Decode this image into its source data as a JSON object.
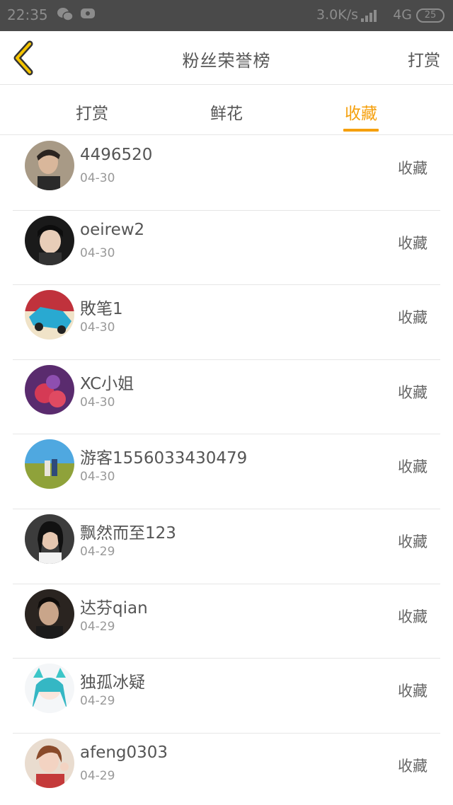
{
  "status_bar": {
    "time": "22:35",
    "network_speed": "3.0K/s",
    "network_type": "4G",
    "battery": "25",
    "icons": [
      "wechat-icon",
      "chat-bubble-icon",
      "signal-icon"
    ]
  },
  "header": {
    "title": "粉丝荣誉榜",
    "right_action": "打赏",
    "back_icon": "chevron-left-icon"
  },
  "tabs": [
    {
      "label": "打赏",
      "active": false
    },
    {
      "label": "鲜花",
      "active": false
    },
    {
      "label": "收藏",
      "active": true
    }
  ],
  "colors": {
    "accent": "#f5a00d",
    "status_bar": "#4a4a4a",
    "text": "#555555",
    "muted": "#999999",
    "divider": "#e6e6e6"
  },
  "fans": [
    {
      "name": "4496520",
      "date": "04-30",
      "action": "收藏"
    },
    {
      "name": "oeirew2",
      "date": "04-30",
      "action": "收藏"
    },
    {
      "name": "敗笔1",
      "date": "04-30",
      "action": "收藏"
    },
    {
      "name": "XC小姐",
      "date": "04-30",
      "action": "收藏"
    },
    {
      "name": "游客1556033430479",
      "date": "04-30",
      "action": "收藏"
    },
    {
      "name": "飘然而至123",
      "date": "04-29",
      "action": "收藏"
    },
    {
      "name": "达芬qian",
      "date": "04-29",
      "action": "收藏"
    },
    {
      "name": "独孤冰疑",
      "date": "04-29",
      "action": "收藏"
    },
    {
      "name": "afeng0303",
      "date": "04-29",
      "action": "收藏"
    }
  ]
}
